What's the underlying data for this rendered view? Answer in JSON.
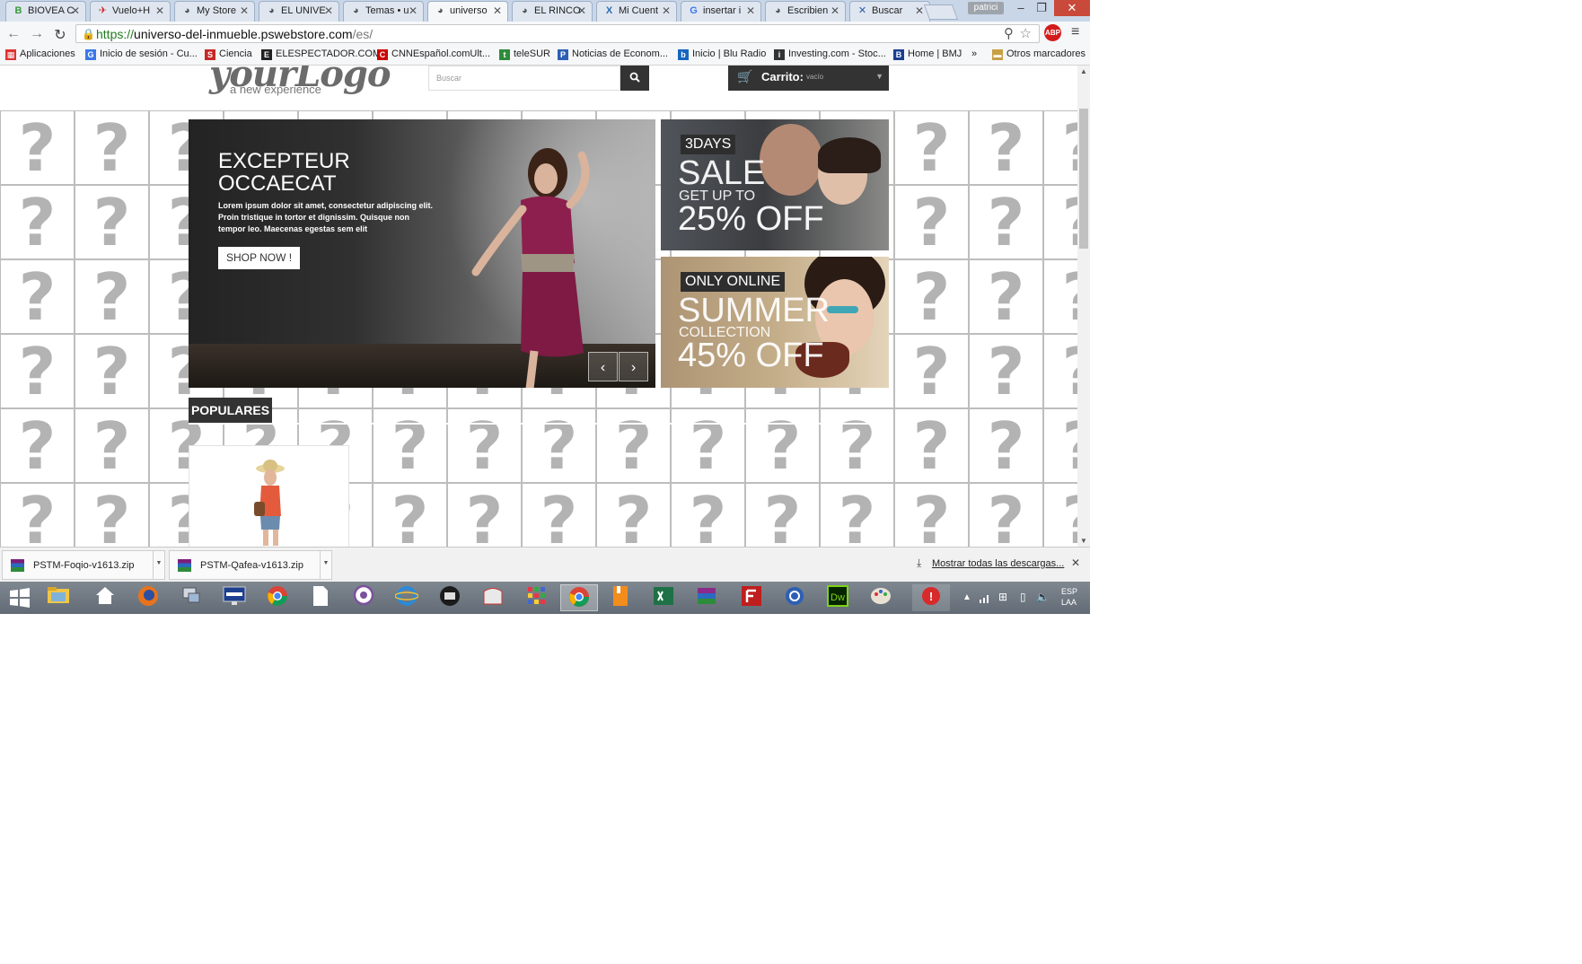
{
  "browser": {
    "tabs": [
      {
        "label": "BIOVEA C",
        "icon": "B",
        "color": "#3a9a3a"
      },
      {
        "label": "Vuelo+H",
        "icon": "✈",
        "color": "#d42b2b"
      },
      {
        "label": "My Store",
        "icon": "◕",
        "color": "#555555"
      },
      {
        "label": "EL UNIVE",
        "icon": "◕",
        "color": "#555555"
      },
      {
        "label": "Temas • u",
        "icon": "◕",
        "color": "#555555"
      },
      {
        "label": "universo",
        "icon": "◕",
        "color": "#555555",
        "active": true
      },
      {
        "label": "EL RINCO",
        "icon": "◕",
        "color": "#555555"
      },
      {
        "label": "Mi Cuent",
        "icon": "X",
        "color": "#2b6cb5"
      },
      {
        "label": "insertar i",
        "icon": "G",
        "color": "#3b78e7"
      },
      {
        "label": "Escribien",
        "icon": "◕",
        "color": "#555555"
      },
      {
        "label": "Buscar",
        "icon": "✕",
        "color": "#2b5ba8"
      }
    ],
    "user": "patrici",
    "url_scheme": "https://",
    "url_host": "universo-del-inmueble.pswebstore.com",
    "url_path": "/es/",
    "abp": "ABP",
    "bookmarks": [
      {
        "label": "Aplicaciones",
        "icon": "apps-icon"
      },
      {
        "label": "Inicio de sesión - Cu...",
        "icon": "google-icon"
      },
      {
        "label": "Ciencia",
        "icon": "s-icon"
      },
      {
        "label": "ELESPECTADOR.COM",
        "icon": "ee-icon"
      },
      {
        "label": "CNNEspañol.comUlt...",
        "icon": "cnn-icon"
      },
      {
        "label": "teleSUR",
        "icon": "telesur-icon"
      },
      {
        "label": "Noticias de Econom...",
        "icon": "p-icon"
      },
      {
        "label": "Inicio | Blu Radio",
        "icon": "blu-icon"
      },
      {
        "label": "Investing.com - Stoc...",
        "icon": "investing-icon"
      },
      {
        "label": "Home | BMJ",
        "icon": "bmj-icon"
      },
      {
        "label": "»",
        "icon": ""
      },
      {
        "label": "Otros marcadores",
        "icon": "folder-icon"
      }
    ]
  },
  "site": {
    "logo": "yourLogo",
    "logo_tagline": "a new experience",
    "search_placeholder": "Buscar",
    "cart_label": "Carrito:",
    "cart_status": "vacío",
    "slide": {
      "title": "EXCEPTEUR OCCAECAT",
      "text": "Lorem ipsum dolor sit amet, consectetur adipiscing elit. Proin tristique in tortor et dignissim. Quisque non tempor leo. Maecenas egestas sem elit",
      "button": "SHOP NOW !"
    },
    "banner1": {
      "tag": "3DAYS",
      "big": "SALE",
      "mid": "GET UP TO",
      "pct": "25% OFF"
    },
    "banner2": {
      "tag": "ONLY ONLINE",
      "big": "SUMMER",
      "mid": "COLLECTION",
      "pct": "45% OFF"
    },
    "section_title": "POPULARES",
    "placeholder_glyph": "?"
  },
  "downloads": {
    "items": [
      "PSTM-Foqio-v1613.zip",
      "PSTM-Qafea-v1613.zip"
    ],
    "show_all": "Mostrar todas las descargas..."
  },
  "taskbar": {
    "language": "ESP",
    "region": "LAA"
  }
}
